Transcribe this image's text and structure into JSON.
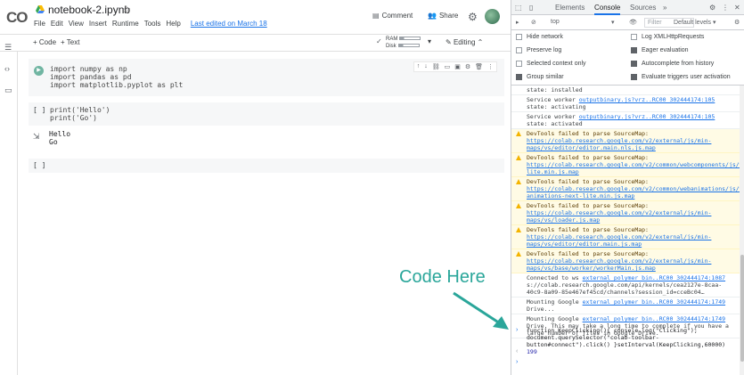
{
  "colab": {
    "logo": "CO",
    "title": "notebook-2.ipynb",
    "menu": [
      "File",
      "Edit",
      "View",
      "Insert",
      "Runtime",
      "Tools",
      "Help"
    ],
    "last_edited": "Last edited on March 18",
    "comment_label": "Comment",
    "share_label": "Share",
    "add_code": "+ Code",
    "add_text": "+ Text",
    "ram_label": "RAM",
    "disk_label": "Disk",
    "editing_label": "Editing",
    "cells": [
      {
        "lines": [
          "import numpy as np",
          "import pandas as pd",
          "import matplotlib.pyplot as plt"
        ],
        "bracket": ""
      },
      {
        "lines": [
          "print('Hello')",
          "print('Go')"
        ],
        "bracket": "[ ]"
      },
      {
        "lines": [],
        "bracket": "[ ]"
      }
    ],
    "output": [
      "Hello",
      "Go"
    ]
  },
  "annotation": {
    "text": "Code Here",
    "color": "#2aa69a"
  },
  "devtools": {
    "tabs": [
      "Elements",
      "Console",
      "Sources",
      "»"
    ],
    "active_tab": "Console",
    "context": "top",
    "filter_placeholder": "Filter",
    "levels": "Default levels ▾",
    "settings": {
      "left": [
        {
          "label": "Hide network",
          "checked": false
        },
        {
          "label": "Preserve log",
          "checked": false
        },
        {
          "label": "Selected context only",
          "checked": false
        },
        {
          "label": "Group similar",
          "checked": true
        }
      ],
      "right": [
        {
          "label": "Log XMLHttpRequests",
          "checked": false
        },
        {
          "label": "Eager evaluation",
          "checked": true
        },
        {
          "label": "Autocomplete from history",
          "checked": true
        },
        {
          "label": "Evaluate triggers user activation",
          "checked": true
        }
      ]
    },
    "logs": [
      {
        "type": "info",
        "text": "state: installed",
        "src": ""
      },
      {
        "type": "info",
        "text": "Service worker",
        "src": "outputbinary.js?vrz..RC00_302444174:105",
        "tail": "state: activating"
      },
      {
        "type": "info",
        "text": "Service worker",
        "src": "outputbinary.js?vrz..RC00_302444174:105",
        "tail": "state: activated"
      },
      {
        "type": "warn",
        "text": "DevTools failed to parse SourceMap:",
        "src": "https://colab.research.google.com/v2/external/js/min-maps/vs/editor/editor.main.nls.js.map",
        "tail": ""
      },
      {
        "type": "warn",
        "text": "DevTools failed to parse SourceMap:",
        "src": "https://colab.research.google.com/v2/common/webcomponents/js/webcomponents-lite.min.js.map",
        "tail": ""
      },
      {
        "type": "warn",
        "text": "DevTools failed to parse SourceMap:",
        "src": "https://colab.research.google.com/v2/common/webanimations/js/web-animations-next-lite.min.js.map",
        "tail": ""
      },
      {
        "type": "warn",
        "text": "DevTools failed to parse SourceMap:",
        "src": "https://colab.research.google.com/v2/external/js/min-maps/vs/loader.js.map",
        "tail": ""
      },
      {
        "type": "warn",
        "text": "DevTools failed to parse SourceMap:",
        "src": "https://colab.research.google.com/v2/external/js/min-maps/vs/editor/editor.main.js.map",
        "tail": ""
      },
      {
        "type": "warn",
        "text": "DevTools failed to parse SourceMap:",
        "src": "https://colab.research.google.com/v2/external/js/min-maps/vs/base/worker/workerMain.js.map",
        "tail": ""
      },
      {
        "type": "info",
        "text": "Connected to ws",
        "src": "external_polymer_bin..RC00_302444174:1087",
        "tail": "s://colab.research.google.com/api/kernels/cea2127e-8caa-40c9-8a09-85e467ef45cd/channels?session_id=cceBc04…"
      },
      {
        "type": "info",
        "text": "Mounting Google",
        "src": "external_polymer_bin..RC00_302444174:1749",
        "tail": "Drive..."
      },
      {
        "type": "info",
        "text": "Mounting Google",
        "src": "external_polymer_bin..RC00_302444174:1749",
        "tail": "Drive. This may take a long time to complete if you have a large number of files in Google Drive."
      }
    ],
    "command": "function KeepClicking(){ console.log(\"Clicking\");\ndocument.querySelector(\"colab-toolbar-button#connect\").click() }setInterval(KeepClicking,60000)",
    "result": "199"
  }
}
